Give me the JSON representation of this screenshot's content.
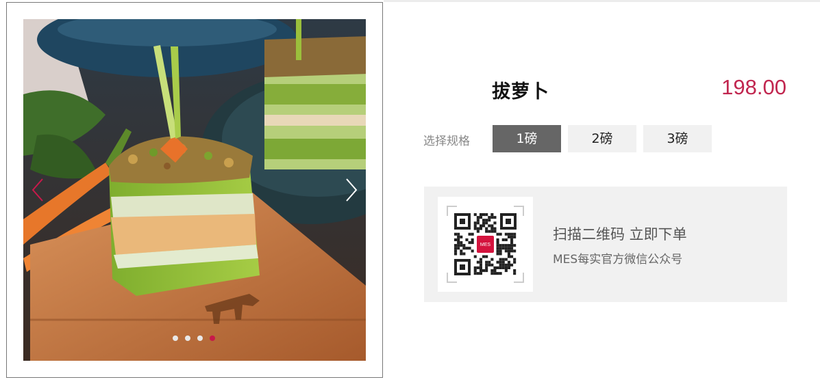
{
  "product": {
    "name": "拔萝卜",
    "price": "198.00"
  },
  "spec": {
    "label": "选择规格",
    "options": [
      "1磅",
      "2磅",
      "3磅"
    ],
    "selected_index": 0
  },
  "qr": {
    "title": "扫描二维码 立即下单",
    "subtitle": "MES每实官方微信公众号",
    "logo_text": "MES"
  },
  "gallery": {
    "slide_count": 4,
    "active_slide_index": 3,
    "image": "carrot-matcha-cake-photo"
  },
  "colors": {
    "accent": "#c1264f",
    "selected_option_bg": "#666666",
    "panel_bg": "#f1f1f1",
    "dot_active": "#c8194a"
  },
  "icons": {
    "prev": "chevron-left-icon",
    "next": "chevron-right-icon"
  }
}
